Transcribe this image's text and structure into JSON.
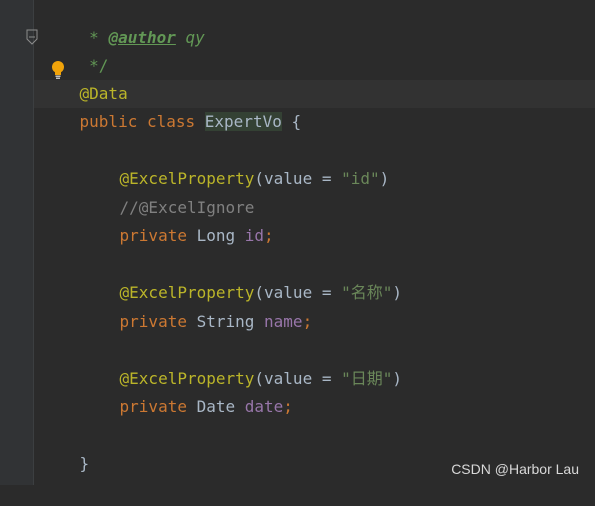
{
  "editor": {
    "lines": {
      "l1": {
        "star": " * ",
        "tag": "@author",
        "value": " qy"
      },
      "l2": {
        "text": " */"
      },
      "l3": {
        "text": "@Data"
      },
      "l4": {
        "kw1": "public",
        "kw2": "class",
        "classname": "ExpertVo",
        "brace": " {"
      },
      "l6": {
        "ann": "@ExcelProperty",
        "open": "(",
        "param": "value",
        "eq": " = ",
        "str": "\"id\"",
        "close": ")"
      },
      "l7": {
        "text": "//@ExcelIgnore"
      },
      "l8": {
        "kw": "private",
        "type": " Long ",
        "field": "id",
        "semi": ";"
      },
      "l10": {
        "ann": "@ExcelProperty",
        "open": "(",
        "param": "value",
        "eq": " = ",
        "str": "\"名称\"",
        "close": ")"
      },
      "l11": {
        "kw": "private",
        "type": " String ",
        "field": "name",
        "semi": ";"
      },
      "l13": {
        "ann": "@ExcelProperty",
        "open": "(",
        "param": "value",
        "eq": " = ",
        "str": "\"日期\"",
        "close": ")"
      },
      "l14": {
        "kw": "private",
        "type": " Date ",
        "field": "date",
        "semi": ";"
      },
      "l16": {
        "text": "}"
      }
    }
  },
  "watermark": "CSDN @Harbor Lau",
  "colors": {
    "background": "#2b2b2b",
    "keyword": "#cc7832",
    "annotation": "#bbb529",
    "string": "#6a8759",
    "field": "#9876aa",
    "text": "#a9b7c6",
    "comment": "#808080",
    "doc": "#629755",
    "bulb": "#f0a30a"
  },
  "icons": {
    "fold": "fold-end-icon",
    "intention": "lightbulb-icon"
  }
}
